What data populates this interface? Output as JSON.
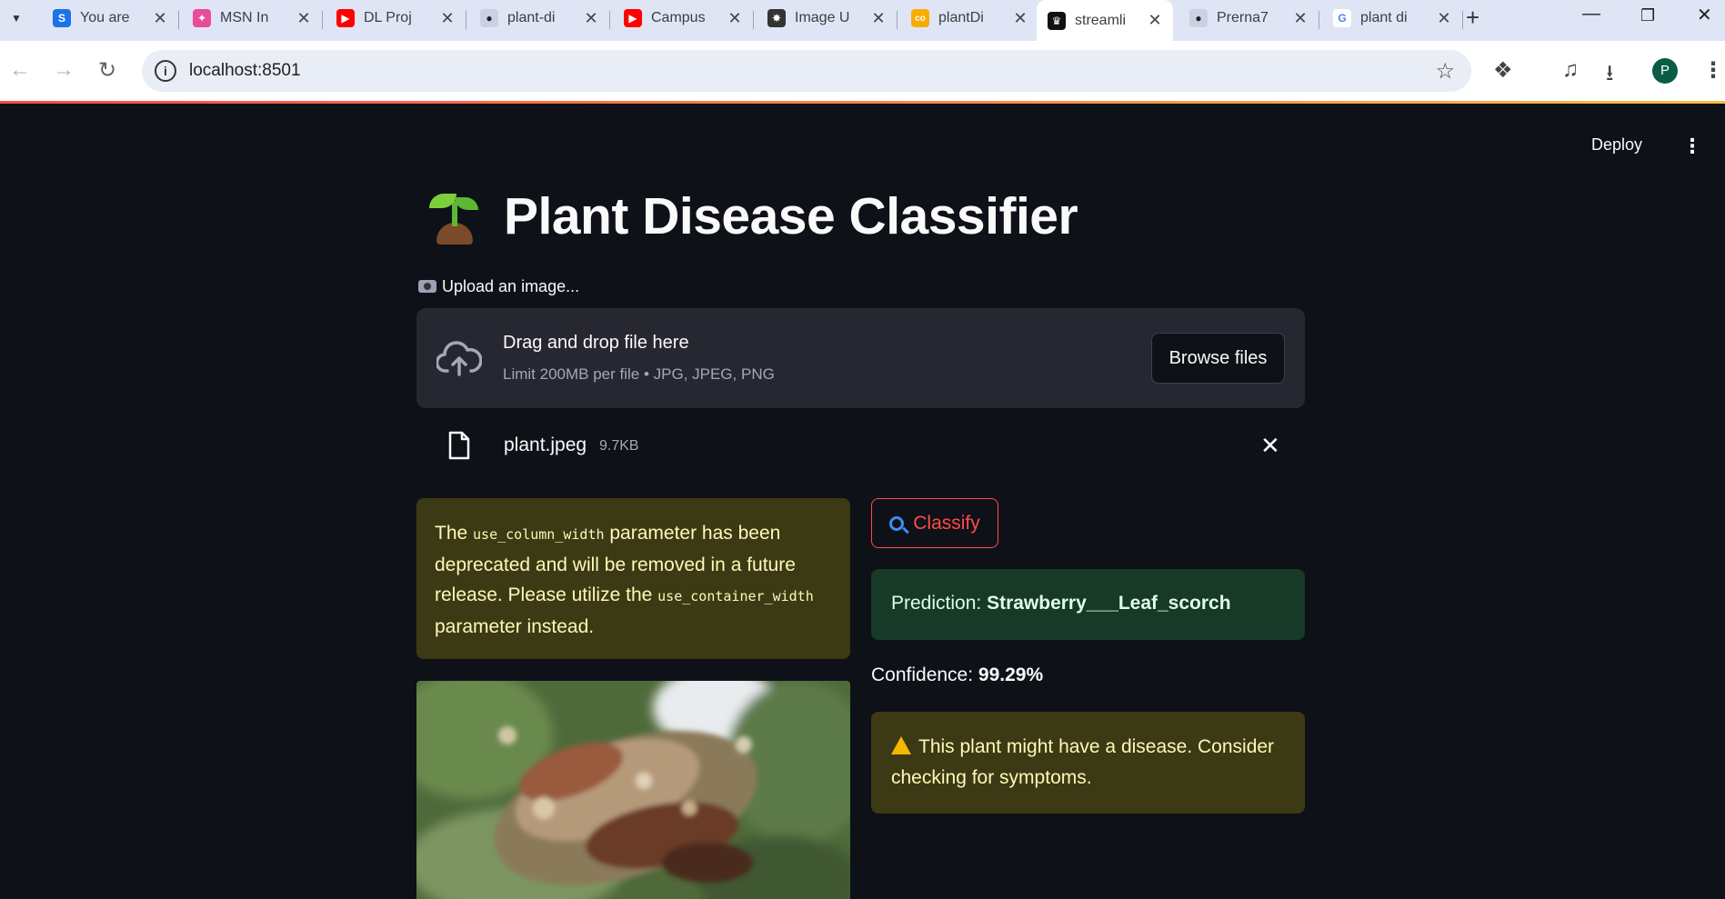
{
  "browser": {
    "tabs": [
      {
        "label": "You are",
        "favicon_color": "#1a73e8",
        "favicon_glyph": "S"
      },
      {
        "label": "MSN In",
        "favicon_color": "#e84d9a",
        "favicon_glyph": "✦"
      },
      {
        "label": "DL Proj",
        "favicon_color": "#ff0000",
        "favicon_glyph": "▶"
      },
      {
        "label": "plant-di",
        "favicon_color": "#c9d1e3",
        "favicon_glyph": "●"
      },
      {
        "label": "Campus",
        "favicon_color": "#ff0000",
        "favicon_glyph": "▶"
      },
      {
        "label": "Image U",
        "favicon_color": "#333333",
        "favicon_glyph": "✸"
      },
      {
        "label": "plantDi",
        "favicon_color": "#f9ab00",
        "favicon_glyph": "co"
      },
      {
        "label": "streamli",
        "favicon_color": "#111111",
        "favicon_glyph": "♛"
      },
      {
        "label": "Prerna7",
        "favicon_color": "#c9d1e3",
        "favicon_glyph": "●"
      },
      {
        "label": "plant di",
        "favicon_color": "#4285f4",
        "favicon_glyph": "G"
      }
    ],
    "active_tab_index": 7,
    "url": "localhost:8501",
    "profile_initial": "P"
  },
  "app": {
    "deploy_label": "Deploy",
    "title": "Plant Disease Classifier",
    "upload_label": "Upload an image...",
    "dropzone": {
      "title": "Drag and drop file here",
      "subtitle": "Limit 200MB per file • JPG, JPEG, PNG",
      "browse_label": "Browse files"
    },
    "file": {
      "name": "plant.jpeg",
      "size": "9.7KB"
    },
    "deprecation_warning": {
      "part1": "The ",
      "code1": "use_column_width",
      "part2": " parameter has been deprecated and will be removed in a future release. Please utilize the ",
      "code2": "use_container_width",
      "part3": " parameter instead."
    },
    "classify_label": "Classify",
    "prediction": {
      "label": "Prediction: ",
      "value": "Strawberry___Leaf_scorch"
    },
    "confidence": {
      "label": "Confidence: ",
      "value": "99.29%"
    },
    "disease_warning": "This plant might have a disease. Consider checking for symptoms."
  },
  "colors": {
    "app_bg": "#0e1117",
    "accent": "#ff4b4b",
    "success_bg": "#173928",
    "warning_bg": "#3c3a14"
  }
}
